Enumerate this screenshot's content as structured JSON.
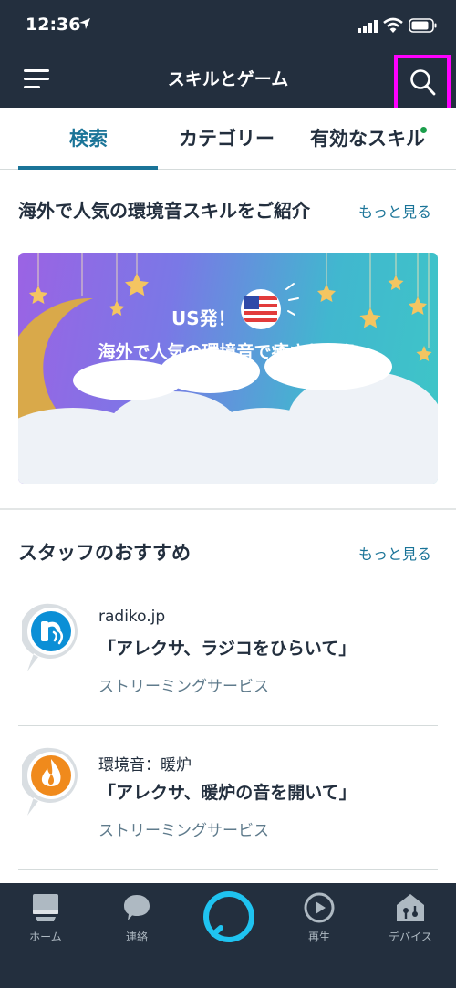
{
  "status_bar": {
    "time": "12:36"
  },
  "header": {
    "title": "スキルとゲーム"
  },
  "tabs": [
    {
      "label": "検索"
    },
    {
      "label": "カテゴリー"
    },
    {
      "label": "有効なスキル"
    }
  ],
  "featured": {
    "title": "海外で人気の環境音スキルをご紹介",
    "more_label": "もっと見る",
    "banner": {
      "line1": "US発！",
      "line2": "海外で人気の環境音で癒されよう"
    }
  },
  "staff_picks": {
    "title": "スタッフのおすすめ",
    "more_label": "もっと見る",
    "items": [
      {
        "name": "radiko.jp",
        "phrase": "「アレクサ、ラジコをひらいて」",
        "category": "ストリーミングサービス",
        "icon": "radiko-icon"
      },
      {
        "name": "環境音：暖炉",
        "phrase": "「アレクサ、暖炉の音を開いて」",
        "category": "ストリーミングサービス",
        "icon": "fireplace-icon"
      }
    ]
  },
  "bottom_nav": {
    "home": "ホーム",
    "communicate": "連絡",
    "play": "再生",
    "devices": "デバイス"
  },
  "colors": {
    "header_bg": "#232f3e",
    "accent": "#1a7498",
    "highlight": "#ff00ff",
    "alexa_ring": "#1fc3f0"
  }
}
